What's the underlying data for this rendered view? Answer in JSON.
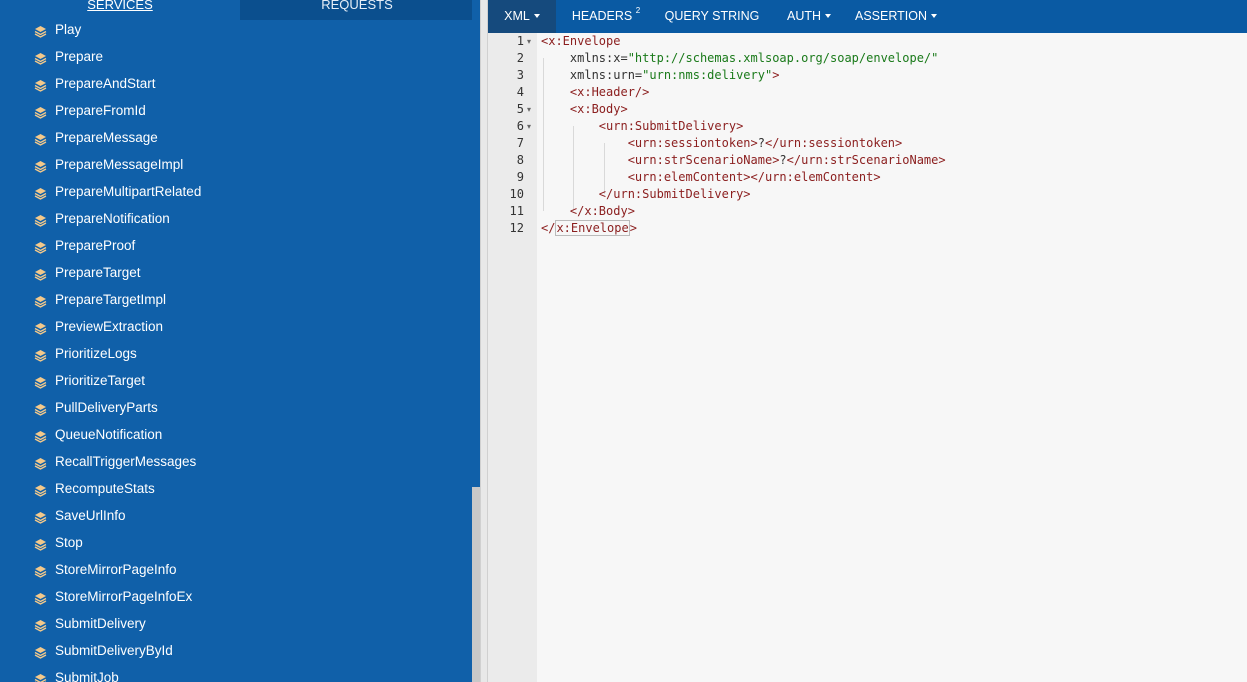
{
  "sidebar": {
    "tabs": {
      "services": "SERVICES",
      "requests": "REQUESTS"
    },
    "items": [
      "Play",
      "Prepare",
      "PrepareAndStart",
      "PrepareFromId",
      "PrepareMessage",
      "PrepareMessageImpl",
      "PrepareMultipartRelated",
      "PrepareNotification",
      "PrepareProof",
      "PrepareTarget",
      "PrepareTargetImpl",
      "PreviewExtraction",
      "PrioritizeLogs",
      "PrioritizeTarget",
      "PullDeliveryParts",
      "QueueNotification",
      "RecallTriggerMessages",
      "RecomputeStats",
      "SaveUrlInfo",
      "Stop",
      "StoreMirrorPageInfo",
      "StoreMirrorPageInfoEx",
      "SubmitDelivery",
      "SubmitDeliveryById",
      "SubmitJob"
    ]
  },
  "editor_tabs": {
    "xml": "XML",
    "headers": "HEADERS",
    "headers_count": "2",
    "query_string": "QUERY STRING",
    "auth": "AUTH",
    "assertion": "ASSERTION"
  },
  "editor": {
    "line_numbers": [
      "1",
      "2",
      "3",
      "4",
      "5",
      "6",
      "7",
      "8",
      "9",
      "10",
      "11",
      "12"
    ],
    "lines": {
      "l1_tag": "<x:Envelope",
      "l2_attr": "xmlns:x=",
      "l2_val": "\"http://schemas.xmlsoap.org/soap/envelope/\"",
      "l3_attr": "xmlns:urn=",
      "l3_val": "\"urn:nms:delivery\"",
      "l3_close": ">",
      "l4_tag": "<x:Header/>",
      "l5_tag": "<x:Body>",
      "l6_tag": "<urn:SubmitDelivery>",
      "l7_open": "<urn:sessiontoken>",
      "l7_text": "?",
      "l7_close": "</urn:sessiontoken>",
      "l8_open": "<urn:strScenarioName>",
      "l8_text": "?",
      "l8_close": "</urn:strScenarioName>",
      "l9_open": "<urn:elemContent>",
      "l9_close": "</urn:elemContent>",
      "l10_tag": "</urn:SubmitDelivery>",
      "l11_tag": "</x:Body>",
      "l12_prefix": "</",
      "l12_name": "x:Envelope",
      "l12_suffix": ">"
    }
  },
  "colors": {
    "sidebar_bg": "#1060a9",
    "topbar_bg": "#0a5aa3",
    "xml_tag": "#8b1e1e",
    "xml_value": "#1a7a1a"
  }
}
